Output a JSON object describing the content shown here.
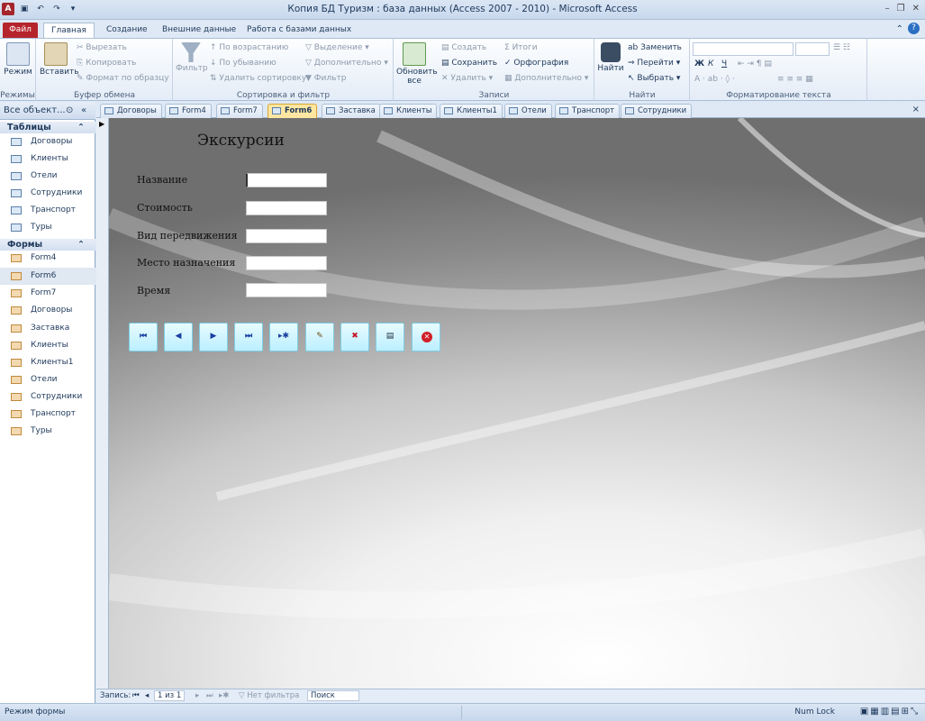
{
  "window": {
    "title": "Копия БД Туризм : база данных (Access 2007 - 2010)  -  Microsoft Access",
    "app_icon": "A"
  },
  "ribbon_tabs": [
    "Файл",
    "Главная",
    "Создание",
    "Внешние данные",
    "Работа с базами данных"
  ],
  "ribbon": {
    "views": {
      "mode": "Режим",
      "group": "Режимы"
    },
    "clipboard": {
      "paste": "Вставить",
      "cut": "Вырезать",
      "copy": "Копировать",
      "format": "Формат по образцу",
      "group": "Буфер обмена"
    },
    "sort_filter": {
      "filter": "Фильтр",
      "asc": "По возрастанию",
      "desc": "По убыванию",
      "remove_sort": "Удалить сортировку",
      "selection": "Выделение",
      "advanced": "Дополнительно",
      "toggle": "Фильтр",
      "group": "Сортировка и фильтр"
    },
    "records": {
      "refresh": "Обновить",
      "refresh2": "все",
      "new": "Создать",
      "save": "Сохранить",
      "delete": "Удалить",
      "totals": "Итоги",
      "spelling": "Орфография",
      "more": "Дополнительно",
      "group": "Записи"
    },
    "find": {
      "find": "Найти",
      "replace": "Заменить",
      "goto": "Перейти",
      "select": "Выбрать",
      "group": "Найти"
    },
    "text": {
      "group": "Форматирование текста"
    }
  },
  "nav": {
    "header": "Все объект...",
    "sections": [
      {
        "title": "Таблицы",
        "items": [
          "Договоры",
          "Клиенты",
          "Отели",
          "Сотрудники",
          "Транспорт",
          "Туры"
        ]
      },
      {
        "title": "Формы",
        "items": [
          "Form4",
          "Form6",
          "Form7",
          "Договоры",
          "Заставка",
          "Клиенты",
          "Клиенты1",
          "Отели",
          "Сотрудники",
          "Транспорт",
          "Туры"
        ]
      }
    ],
    "selected": "Form6"
  },
  "doc_tabs": [
    "Договоры",
    "Form4",
    "Form7",
    "Form6",
    "Заставка",
    "Клиенты",
    "Клиенты1",
    "Отели",
    "Транспорт",
    "Сотрудники"
  ],
  "active_doc_tab": "Form6",
  "form": {
    "title": "Экскурсии",
    "fields": [
      {
        "label": "Название",
        "value": ""
      },
      {
        "label": "Стоимость",
        "value": ""
      },
      {
        "label": "Вид передвижения",
        "value": ""
      },
      {
        "label": "Место назначения",
        "value": ""
      },
      {
        "label": "Время",
        "value": ""
      }
    ],
    "buttons": [
      "first-record",
      "previous-record",
      "next-record",
      "last-record",
      "new-record",
      "edit-record",
      "delete-record",
      "form-view",
      "close"
    ]
  },
  "record_nav": {
    "label": "Запись:",
    "position": "1 из 1",
    "filter": "Нет фильтра",
    "search": "Поиск"
  },
  "status": {
    "left": "Режим формы",
    "numlock": "Num Lock"
  },
  "colors": {
    "file_tab": "#b6242b",
    "active_doc_tab": "#ffe7a2",
    "nav_button": "#bcefff"
  }
}
